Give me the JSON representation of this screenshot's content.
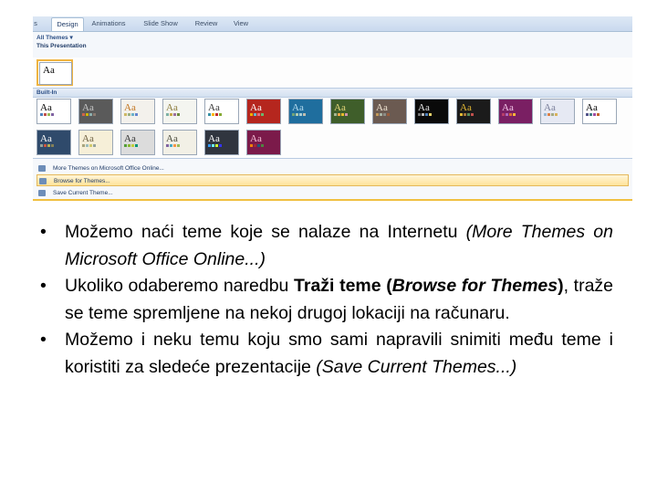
{
  "ribbon": {
    "tabs": [
      "s",
      "Design",
      "Animations",
      "Slide Show",
      "Review",
      "View"
    ],
    "active_tab": "Design"
  },
  "gallery": {
    "all_themes": "All Themes ▾",
    "this_presentation": "This Presentation",
    "built_in": "Built-In",
    "current_theme_sample": "Aa",
    "row1": [
      {
        "label": "Aa",
        "bg": "#ffffff",
        "fg": "#000000",
        "accents": [
          "#4f81bd",
          "#c0504d",
          "#9bbb59",
          "#8064a2"
        ]
      },
      {
        "label": "Aa",
        "bg": "#5a5a5a",
        "fg": "#c8c8c8",
        "accents": [
          "#d16349",
          "#ccb400",
          "#8cadae",
          "#8c7b70"
        ]
      },
      {
        "label": "Aa",
        "bg": "#f3f1ec",
        "fg": "#c2741d",
        "accents": [
          "#ceb966",
          "#9cb084",
          "#6bb1c9",
          "#6585cf"
        ]
      },
      {
        "label": "Aa",
        "bg": "#f4f5f0",
        "fg": "#8a7a3a",
        "accents": [
          "#7fb2a6",
          "#caa94a",
          "#9b6f9e",
          "#6e8b3d"
        ]
      },
      {
        "label": "Aa",
        "bg": "#ffffff",
        "fg": "#333333",
        "accents": [
          "#3891a7",
          "#feb80a",
          "#c32d2e",
          "#84aa33"
        ]
      },
      {
        "label": "Aa",
        "bg": "#b5261e",
        "fg": "#ffffff",
        "accents": [
          "#f0ad00",
          "#60b5cc",
          "#e66c7d",
          "#6bb76d"
        ]
      },
      {
        "label": "Aa",
        "bg": "#1f6e9e",
        "fg": "#b6dcef",
        "accents": [
          "#72a376",
          "#b0ccb0",
          "#a8cdd7",
          "#c0beaf"
        ]
      },
      {
        "label": "Aa",
        "bg": "#3f5e2a",
        "fg": "#e7d87a",
        "accents": [
          "#a5b592",
          "#f3a447",
          "#e7bc29",
          "#d092a7"
        ]
      },
      {
        "label": "Aa",
        "bg": "#6b5a51",
        "fg": "#f0e4d2",
        "accents": [
          "#c19859",
          "#a8b4a5",
          "#8c8d86",
          "#9b5c3b"
        ]
      },
      {
        "label": "Aa",
        "bg": "#0a0a0a",
        "fg": "#e8e8e8",
        "accents": [
          "#6f6f6f",
          "#bdbdbd",
          "#4f81bd",
          "#e8d26b"
        ]
      },
      {
        "label": "Aa",
        "bg": "#1b1b1b",
        "fg": "#e2b833",
        "accents": [
          "#e2b833",
          "#a6753a",
          "#5b8c5a",
          "#c0504d"
        ]
      },
      {
        "label": "Aa",
        "bg": "#7a1f63",
        "fg": "#f4c7ea",
        "accents": [
          "#b83d68",
          "#ac66bb",
          "#de6c36",
          "#f9b639"
        ]
      },
      {
        "label": "Aa",
        "bg": "#e6e9f3",
        "fg": "#7a7f9a",
        "accents": [
          "#94b6d2",
          "#dd8047",
          "#a5ab81",
          "#d8b25c"
        ]
      },
      {
        "label": "Aa",
        "bg": "#ffffff",
        "fg": "#000000",
        "accents": [
          "#53548a",
          "#438086",
          "#a04da3",
          "#c4652d"
        ]
      }
    ],
    "row2": [
      {
        "label": "Aa",
        "bg": "#2f4a6b",
        "fg": "#ffffff",
        "accents": [
          "#93a299",
          "#cf543f",
          "#b5ae53",
          "#848058"
        ]
      },
      {
        "label": "Aa",
        "bg": "#f6efd8",
        "fg": "#6f6141",
        "accents": [
          "#a9a57c",
          "#9cbebd",
          "#d2cb6c",
          "#95a39d"
        ]
      },
      {
        "label": "Aa",
        "bg": "#dcdcdc",
        "fg": "#333333",
        "accents": [
          "#549e39",
          "#8ab833",
          "#c0cf3a",
          "#029676"
        ]
      },
      {
        "label": "Aa",
        "bg": "#f2f0e6",
        "fg": "#4a4a3a",
        "accents": [
          "#8064a2",
          "#4bacc6",
          "#f79646",
          "#9bbb59"
        ]
      },
      {
        "label": "Aa",
        "bg": "#30353f",
        "fg": "#ffffff",
        "accents": [
          "#3399ff",
          "#69ffff",
          "#ccff33",
          "#3333ff"
        ]
      },
      {
        "label": "Aa",
        "bg": "#7b1a4a",
        "fg": "#f5c0d8",
        "accents": [
          "#f07f09",
          "#9f2936",
          "#1b587c",
          "#4e8542"
        ]
      }
    ]
  },
  "menu": {
    "items": [
      {
        "label": "More Themes on Microsoft Office Online...",
        "icon": "globe-icon"
      },
      {
        "label": "Browse for Themes...",
        "icon": "folder-open-icon"
      },
      {
        "label": "Save Current Theme...",
        "icon": "save-icon"
      }
    ]
  },
  "bullets": [
    {
      "parts": [
        {
          "text": "Možemo naći teme koje se nalaze na Internetu ",
          "style": "normal"
        },
        {
          "text": "(More Themes on Microsoft Office Online...)",
          "style": "italic"
        }
      ]
    },
    {
      "parts": [
        {
          "text": "Ukoliko odaberemo naredbu ",
          "style": "normal"
        },
        {
          "text": "Traži teme (",
          "style": "bold"
        },
        {
          "text": "Browse for Themes",
          "style": "bolditalic"
        },
        {
          "text": ")",
          "style": "bold"
        },
        {
          "text": ", traže se teme spremljene na nekoj drugoj lokaciji na računaru.",
          "style": "normal"
        }
      ]
    },
    {
      "parts": [
        {
          "text": "Možemo i neku temu koju smo sami napravili snimiti među teme i koristiti za sledeće prezentacije ",
          "style": "normal"
        },
        {
          "text": "(Save Current Themes...)",
          "style": "italic"
        }
      ]
    }
  ],
  "bullet_char": "•"
}
